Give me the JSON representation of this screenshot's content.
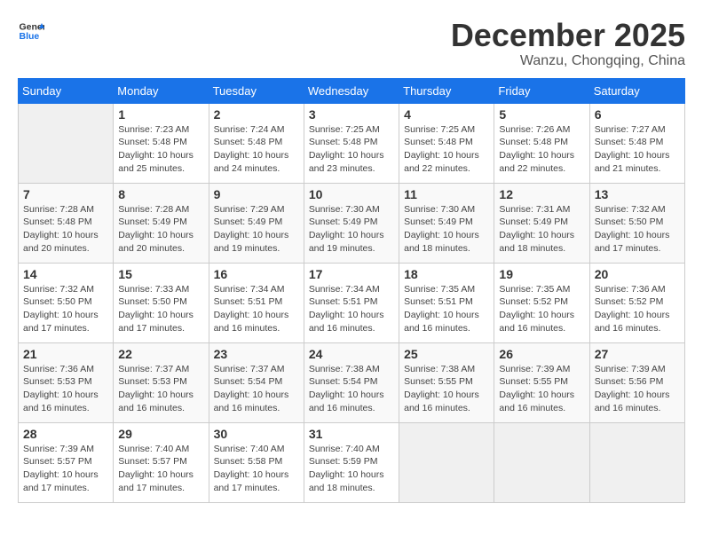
{
  "logo": {
    "line1": "General",
    "line2": "Blue"
  },
  "title": "December 2025",
  "location": "Wanzu, Chongqing, China",
  "days_of_week": [
    "Sunday",
    "Monday",
    "Tuesday",
    "Wednesday",
    "Thursday",
    "Friday",
    "Saturday"
  ],
  "weeks": [
    [
      {
        "day": "",
        "info": ""
      },
      {
        "day": "1",
        "info": "Sunrise: 7:23 AM\nSunset: 5:48 PM\nDaylight: 10 hours\nand 25 minutes."
      },
      {
        "day": "2",
        "info": "Sunrise: 7:24 AM\nSunset: 5:48 PM\nDaylight: 10 hours\nand 24 minutes."
      },
      {
        "day": "3",
        "info": "Sunrise: 7:25 AM\nSunset: 5:48 PM\nDaylight: 10 hours\nand 23 minutes."
      },
      {
        "day": "4",
        "info": "Sunrise: 7:25 AM\nSunset: 5:48 PM\nDaylight: 10 hours\nand 22 minutes."
      },
      {
        "day": "5",
        "info": "Sunrise: 7:26 AM\nSunset: 5:48 PM\nDaylight: 10 hours\nand 22 minutes."
      },
      {
        "day": "6",
        "info": "Sunrise: 7:27 AM\nSunset: 5:48 PM\nDaylight: 10 hours\nand 21 minutes."
      }
    ],
    [
      {
        "day": "7",
        "info": "Sunrise: 7:28 AM\nSunset: 5:48 PM\nDaylight: 10 hours\nand 20 minutes."
      },
      {
        "day": "8",
        "info": "Sunrise: 7:28 AM\nSunset: 5:49 PM\nDaylight: 10 hours\nand 20 minutes."
      },
      {
        "day": "9",
        "info": "Sunrise: 7:29 AM\nSunset: 5:49 PM\nDaylight: 10 hours\nand 19 minutes."
      },
      {
        "day": "10",
        "info": "Sunrise: 7:30 AM\nSunset: 5:49 PM\nDaylight: 10 hours\nand 19 minutes."
      },
      {
        "day": "11",
        "info": "Sunrise: 7:30 AM\nSunset: 5:49 PM\nDaylight: 10 hours\nand 18 minutes."
      },
      {
        "day": "12",
        "info": "Sunrise: 7:31 AM\nSunset: 5:49 PM\nDaylight: 10 hours\nand 18 minutes."
      },
      {
        "day": "13",
        "info": "Sunrise: 7:32 AM\nSunset: 5:50 PM\nDaylight: 10 hours\nand 17 minutes."
      }
    ],
    [
      {
        "day": "14",
        "info": "Sunrise: 7:32 AM\nSunset: 5:50 PM\nDaylight: 10 hours\nand 17 minutes."
      },
      {
        "day": "15",
        "info": "Sunrise: 7:33 AM\nSunset: 5:50 PM\nDaylight: 10 hours\nand 17 minutes."
      },
      {
        "day": "16",
        "info": "Sunrise: 7:34 AM\nSunset: 5:51 PM\nDaylight: 10 hours\nand 16 minutes."
      },
      {
        "day": "17",
        "info": "Sunrise: 7:34 AM\nSunset: 5:51 PM\nDaylight: 10 hours\nand 16 minutes."
      },
      {
        "day": "18",
        "info": "Sunrise: 7:35 AM\nSunset: 5:51 PM\nDaylight: 10 hours\nand 16 minutes."
      },
      {
        "day": "19",
        "info": "Sunrise: 7:35 AM\nSunset: 5:52 PM\nDaylight: 10 hours\nand 16 minutes."
      },
      {
        "day": "20",
        "info": "Sunrise: 7:36 AM\nSunset: 5:52 PM\nDaylight: 10 hours\nand 16 minutes."
      }
    ],
    [
      {
        "day": "21",
        "info": "Sunrise: 7:36 AM\nSunset: 5:53 PM\nDaylight: 10 hours\nand 16 minutes."
      },
      {
        "day": "22",
        "info": "Sunrise: 7:37 AM\nSunset: 5:53 PM\nDaylight: 10 hours\nand 16 minutes."
      },
      {
        "day": "23",
        "info": "Sunrise: 7:37 AM\nSunset: 5:54 PM\nDaylight: 10 hours\nand 16 minutes."
      },
      {
        "day": "24",
        "info": "Sunrise: 7:38 AM\nSunset: 5:54 PM\nDaylight: 10 hours\nand 16 minutes."
      },
      {
        "day": "25",
        "info": "Sunrise: 7:38 AM\nSunset: 5:55 PM\nDaylight: 10 hours\nand 16 minutes."
      },
      {
        "day": "26",
        "info": "Sunrise: 7:39 AM\nSunset: 5:55 PM\nDaylight: 10 hours\nand 16 minutes."
      },
      {
        "day": "27",
        "info": "Sunrise: 7:39 AM\nSunset: 5:56 PM\nDaylight: 10 hours\nand 16 minutes."
      }
    ],
    [
      {
        "day": "28",
        "info": "Sunrise: 7:39 AM\nSunset: 5:57 PM\nDaylight: 10 hours\nand 17 minutes."
      },
      {
        "day": "29",
        "info": "Sunrise: 7:40 AM\nSunset: 5:57 PM\nDaylight: 10 hours\nand 17 minutes."
      },
      {
        "day": "30",
        "info": "Sunrise: 7:40 AM\nSunset: 5:58 PM\nDaylight: 10 hours\nand 17 minutes."
      },
      {
        "day": "31",
        "info": "Sunrise: 7:40 AM\nSunset: 5:59 PM\nDaylight: 10 hours\nand 18 minutes."
      },
      {
        "day": "",
        "info": ""
      },
      {
        "day": "",
        "info": ""
      },
      {
        "day": "",
        "info": ""
      }
    ]
  ]
}
